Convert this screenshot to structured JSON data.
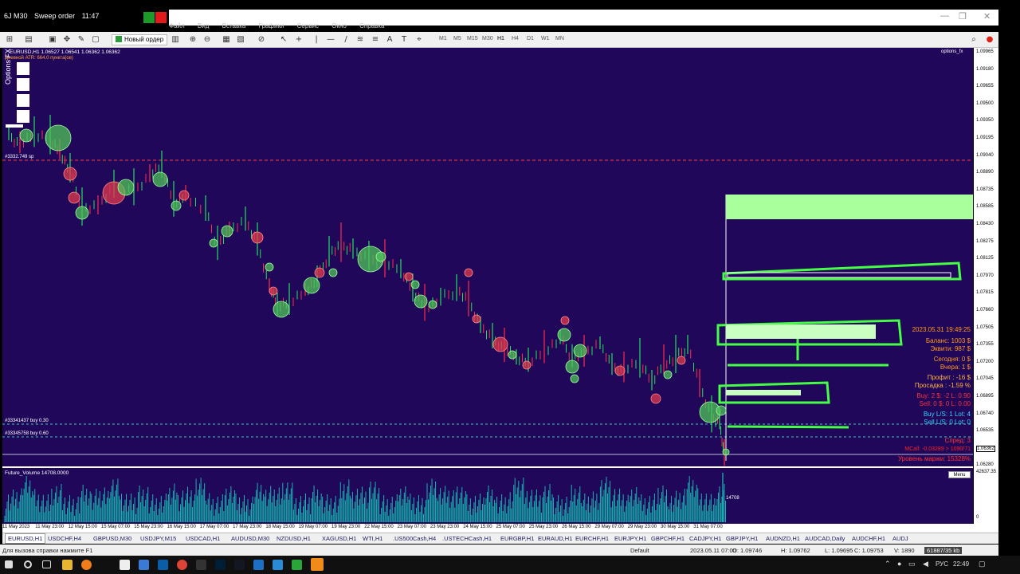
{
  "window": {
    "title": "6J M30",
    "subtitle": "Sweep order",
    "time": "11:47"
  },
  "menu": [
    "Файл",
    "Вид",
    "Вставка",
    "Графики",
    "Сервис",
    "Окно",
    "Справка"
  ],
  "toolbar": {
    "new_order": "Новый ордер",
    "timeframes": [
      "M1",
      "M5",
      "M15",
      "M30",
      "H1",
      "H4",
      "D1",
      "W1",
      "MN"
    ],
    "active_timeframe": "H1"
  },
  "chart": {
    "header_line1": "EURUSD,H1  1.06527 1.06541 1.06362 1.06362",
    "header_line2": "Дневной ATR: 664.0 пункта(ов)",
    "top_right_label": "options_fx",
    "vertical_panel_label": "Options FX",
    "order_line_label": "#3332.749 sp",
    "buy_line1": "#33341437 buy 0.30",
    "buy_line2": "#33345758 buy 0.60",
    "price_ticks": [
      "1.09965",
      "1.09180",
      "1.09655",
      "1.09500",
      "1.09350",
      "1.09195",
      "1.09040",
      "1.08890",
      "1.08735",
      "1.08585",
      "1.08430",
      "1.08275",
      "1.08125",
      "1.07970",
      "1.07815",
      "1.07660",
      "1.07505",
      "1.07355",
      "1.07200",
      "1.07045",
      "1.06895",
      "1.06740",
      "1.06535",
      "1.06362",
      "1.06280"
    ],
    "current_price": "1.06362",
    "colors": {
      "background": "#21075a",
      "bull": "#22e05a",
      "bear": "#ff2b4a",
      "highlight": "#a9ff9b"
    }
  },
  "info_panel": {
    "datetime": "2023.05.31 19:49:25",
    "balance": "Баланс: 1003 $",
    "equity": "Эквити: 987 $",
    "today": "Сегодня: 0 $",
    "yesterday": "Вчера: 1 $",
    "profit": "Профит : -16 $",
    "drawdown": "Просадка : -1.59 %",
    "buy_line": "Buy: 2  $: -2  L: 0.90",
    "sell_line": "Sell: 0  $: 0  L: 0.00",
    "buy_ls": "Buy L/S: 1   Lot: 4",
    "sell_ls": "Sell L/S: 0   Lot: 0",
    "spread": "Спред: 3",
    "mcall": "MCall: -0.03289 > 1090/71",
    "margin_level": "Уровень маржи: 15328%"
  },
  "subchart": {
    "label": "Future_Volume 14708.0000",
    "last_value": "14708",
    "axis_top": "42637.35",
    "axis_bottom": "0",
    "menu_button": "Menu"
  },
  "time_ticks": [
    "11 May 2023",
    "11 May 23:00",
    "12 May 15:00",
    "15 May 07:00",
    "15 May 23:00",
    "16 May 15:00",
    "17 May 07:00",
    "17 May 23:00",
    "18 May 15:00",
    "19 May 07:00",
    "19 May 23:00",
    "22 May 15:00",
    "23 May 07:00",
    "23 May 23:00",
    "24 May 15:00",
    "25 May 07:00",
    "25 May 23:00",
    "26 May 15:00",
    "29 May 07:00",
    "29 May 23:00",
    "30 May 15:00",
    "31 May 07:00"
  ],
  "symbol_tabs": [
    "EURUSD,H1",
    "USDCHF,H4",
    "GBPUSD,M30",
    "USDJPY,M15",
    "USDCAD,H1",
    "AUDUSD,M30",
    "NZDUSD,H1",
    "XAGUSD,H1",
    "WTI,H1",
    ".US500Cash,H4",
    ".USTECHCash,H1",
    "EURGBP,H1",
    "EURAUD,H1",
    "EURCHF,H1",
    "EURJPY,H1",
    "GBPCHF,H1",
    "CADJPY,H1",
    "GBPJPY,H1",
    "AUDNZD,H1",
    "AUDCAD,Daily",
    "AUDCHF,H1",
    "AUDJ"
  ],
  "status": {
    "help": "Для вызова справки нажмите F1",
    "profile": "Default",
    "datetime": "2023.05.11 07:00",
    "open": "O: 1.09746",
    "high": "H: 1.09762",
    "low": "L: 1.09695",
    "close": "C: 1.09753",
    "volume": "V: 1890",
    "traffic": "61887/35 kb"
  },
  "taskbar": {
    "lang": "РУС",
    "clock": "22:49"
  }
}
